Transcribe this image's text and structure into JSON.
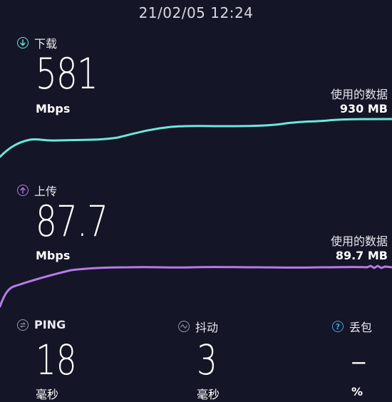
{
  "datetime": "21/02/05 12:24",
  "download": {
    "label": "下载",
    "value": "581",
    "unit": "Mbps",
    "data_used_label": "使用的数据",
    "data_used_value": "930 MB",
    "color": "#6ee7dc"
  },
  "upload": {
    "label": "上传",
    "value": "87.7",
    "unit": "Mbps",
    "data_used_label": "使用的数据",
    "data_used_value": "89.7 MB",
    "color": "#b77be8"
  },
  "stats": {
    "ping": {
      "label": "PING",
      "value": "18",
      "unit": "毫秒"
    },
    "jitter": {
      "label": "抖动",
      "value": "3",
      "unit": "毫秒"
    },
    "loss": {
      "label": "丢包",
      "value": "–",
      "unit": "%"
    }
  },
  "icons": {
    "download": "download-arrow-icon",
    "upload": "upload-arrow-icon",
    "ping": "ping-exchange-icon",
    "jitter": "jitter-wave-icon",
    "loss": "help-question-icon"
  }
}
